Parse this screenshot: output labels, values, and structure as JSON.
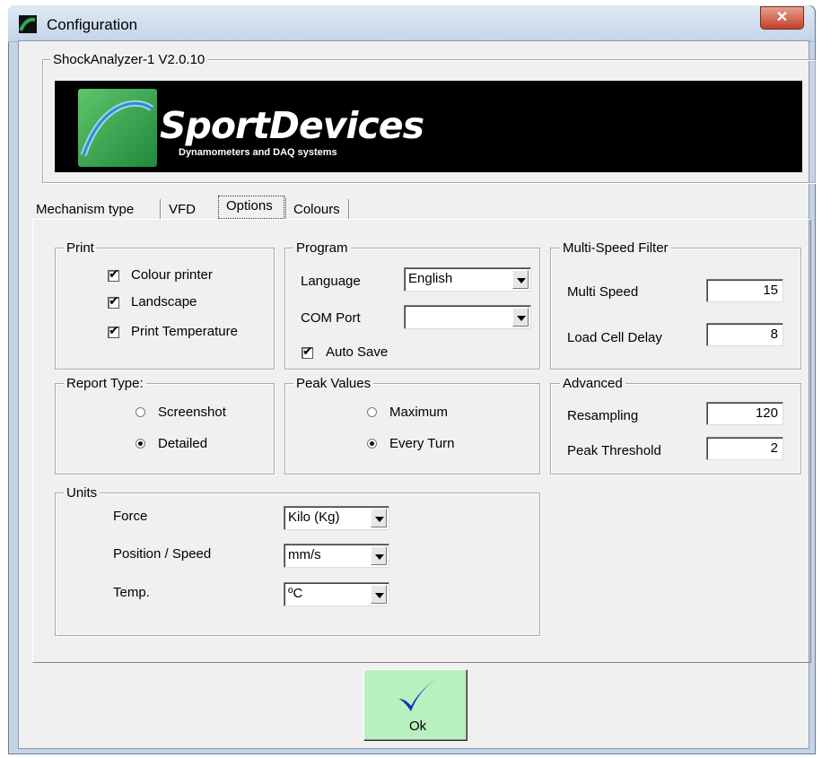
{
  "window": {
    "title": "Configuration",
    "close_glyph": "✕"
  },
  "version_group": {
    "label": "ShockAnalyzer-1 V2.0.10"
  },
  "logo": {
    "brand": "SportDevices",
    "tagline": "Dynamometers and DAQ systems"
  },
  "tabs": [
    {
      "label": "Mechanism type"
    },
    {
      "label": "VFD"
    },
    {
      "label": "Options"
    },
    {
      "label": "Colours"
    }
  ],
  "print": {
    "label": "Print",
    "items": [
      {
        "label": "Colour printer",
        "checked": true
      },
      {
        "label": "Landscape",
        "checked": true
      },
      {
        "label": "Print Temperature",
        "checked": true
      }
    ]
  },
  "program": {
    "label": "Program",
    "language_label": "Language",
    "language_value": "English",
    "com_label": "COM Port",
    "com_value": "",
    "autosave_label": "Auto Save"
  },
  "multispeed": {
    "label": "Multi-Speed Filter",
    "multi_speed_label": "Multi Speed",
    "multi_speed_value": "15",
    "load_cell_label": "Load Cell Delay",
    "load_cell_value": "8"
  },
  "report_type": {
    "label": "Report Type:",
    "options": [
      {
        "label": "Screenshot",
        "selected": false
      },
      {
        "label": "Detailed",
        "selected": true
      }
    ]
  },
  "peak_values": {
    "label": "Peak Values",
    "options": [
      {
        "label": "Maximum",
        "selected": false
      },
      {
        "label": "Every Turn",
        "selected": true
      }
    ]
  },
  "advanced": {
    "label": "Advanced",
    "resampling_label": "Resampling",
    "resampling_value": "120",
    "peak_threshold_label": "Peak Threshold",
    "peak_threshold_value": "2"
  },
  "units": {
    "label": "Units",
    "force_label": "Force",
    "force_value": "Kilo (Kg)",
    "position_label": "Position / Speed",
    "position_value": "mm/s",
    "temp_label": "Temp.",
    "temp_value": "ºC"
  },
  "ok_button": {
    "label": "Ok"
  },
  "colors": {
    "ok_bg": "#b8f0c0",
    "check_blue": "#1a2fb8",
    "logo_green": "#2fa84f"
  }
}
